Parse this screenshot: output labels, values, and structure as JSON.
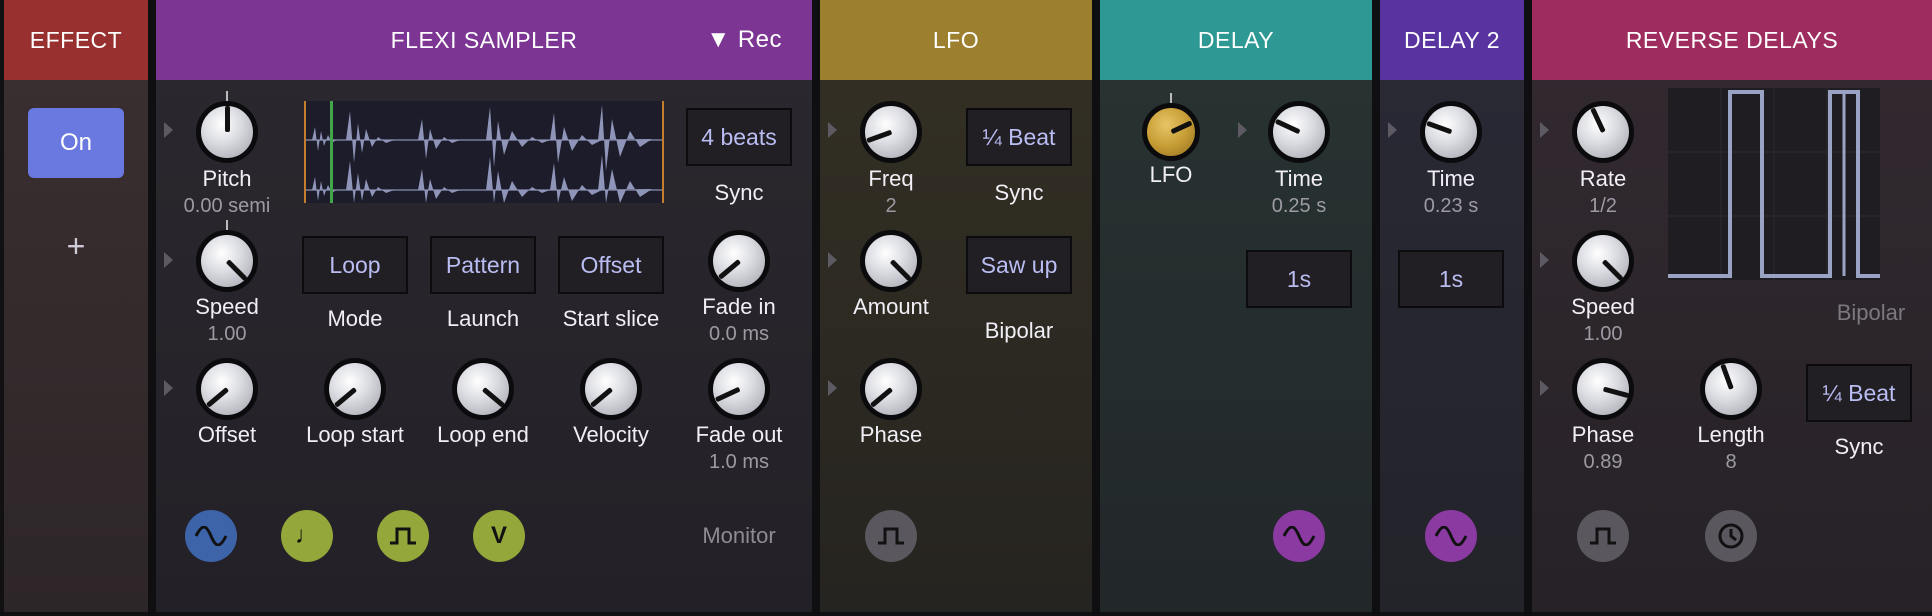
{
  "colors": {
    "effect": "#97302f",
    "flexi": "#7c3593",
    "lfo": "#9c8030",
    "delay": "#2e9894",
    "delay2": "#5934a0",
    "reverse": "#9e2c5f",
    "on_button": "#6a79e0",
    "accent_text": "#b9bdf2"
  },
  "effect": {
    "title": "EFFECT",
    "on_label": "On",
    "add_label": "+"
  },
  "flexi": {
    "title": "FLEXI SAMPLER",
    "rec_label": "▼ Rec",
    "pitch": {
      "label": "Pitch",
      "value": "0.00 semi"
    },
    "length_button": "4 beats",
    "sync_label": "Sync",
    "speed": {
      "label": "Speed",
      "value": "1.00"
    },
    "mode": {
      "button": "Loop",
      "label": "Mode"
    },
    "launch": {
      "button": "Pattern",
      "label": "Launch"
    },
    "start_slice": {
      "button": "Offset",
      "label": "Start slice"
    },
    "fade_in": {
      "label": "Fade in",
      "value": "0.0 ms"
    },
    "offset": {
      "label": "Offset"
    },
    "loop_start": {
      "label": "Loop start"
    },
    "loop_end": {
      "label": "Loop end"
    },
    "velocity": {
      "label": "Velocity"
    },
    "fade_out": {
      "label": "Fade out",
      "value": "1.0 ms"
    },
    "monitor_label": "Monitor",
    "bottom_icons": [
      "sine-wave-icon",
      "music-note-icon",
      "square-wave-icon",
      "velocity-v-icon"
    ],
    "note_glyph": "♩",
    "v_glyph": "V"
  },
  "lfo": {
    "title": "LFO",
    "freq": {
      "label": "Freq",
      "value": "2"
    },
    "sync_button": "¼ Beat",
    "sync_label": "Sync",
    "amount": {
      "label": "Amount"
    },
    "shape_button": "Saw up",
    "bipolar_label": "Bipolar",
    "phase": {
      "label": "Phase"
    }
  },
  "delay": {
    "title": "DELAY",
    "lfo_knob_label": "LFO",
    "time": {
      "label": "Time",
      "value": "0.25 s"
    },
    "time_button": "1s"
  },
  "delay2": {
    "title": "DELAY 2",
    "time": {
      "label": "Time",
      "value": "0.23 s"
    },
    "time_button": "1s"
  },
  "reverse": {
    "title": "REVERSE DELAYS",
    "rate": {
      "label": "Rate",
      "value": "1/2"
    },
    "speed": {
      "label": "Speed",
      "value": "1.00"
    },
    "bipolar_label": "Bipolar",
    "phase": {
      "label": "Phase",
      "value": "0.89"
    },
    "length": {
      "label": "Length",
      "value": "8"
    },
    "sync_button": "¼ Beat",
    "sync_label": "Sync"
  }
}
